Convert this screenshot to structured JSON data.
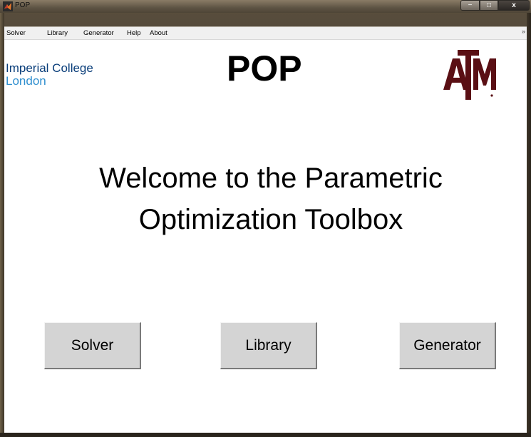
{
  "window": {
    "title": "POP",
    "min_glyph": "−",
    "max_glyph": "□",
    "close_glyph": "x"
  },
  "menu": {
    "items": [
      "Solver",
      "Library",
      "Generator",
      "Help",
      "About"
    ],
    "overflow_glyph": "»"
  },
  "header": {
    "imperial_line1": "Imperial College",
    "imperial_line2": "London",
    "title": "POP",
    "tamu_logo": "ATM"
  },
  "welcome": {
    "line1": "Welcome to the Parametric",
    "line2": "Optimization Toolbox"
  },
  "buttons": {
    "solver": "Solver",
    "library": "Library",
    "generator": "Generator"
  },
  "colors": {
    "imperial_blue": "#0a3e7a",
    "imperial_light_blue": "#2f8fcf",
    "tamu_maroon": "#5a0f14",
    "button_face": "#d4d4d4"
  }
}
